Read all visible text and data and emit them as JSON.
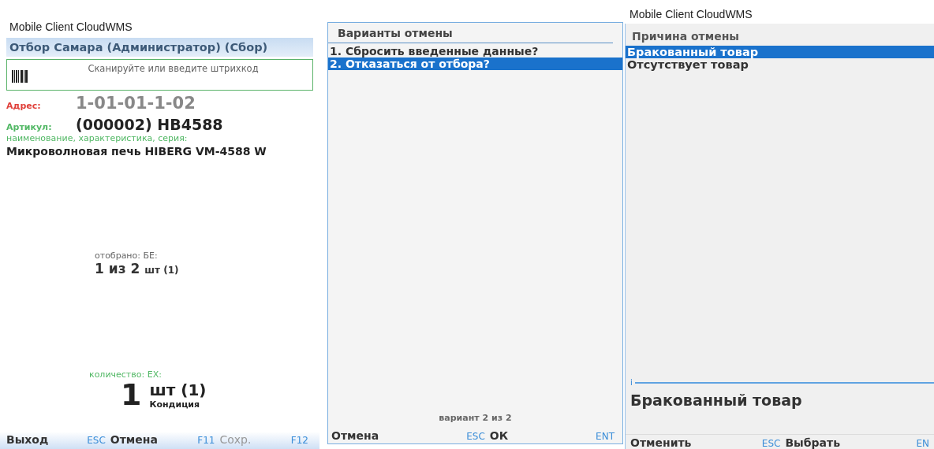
{
  "screen_1": {
    "app_title": "Mobile Client CloudWMS",
    "header": "Отбор Самара (Администратор)  (Сбор)",
    "scan": {
      "placeholder": "Сканируйте или введите штрихкод"
    },
    "address": {
      "label": "Адрес:",
      "value": "1-01-01-1-02"
    },
    "article": {
      "label": "Артикул:",
      "value": "(000002) HB4588"
    },
    "name_label": "наименование,  характеристика,  серия:",
    "name_value": "Микроволновая печь HIBERG VM-4588 W",
    "picked": {
      "label": "отобрано: БЕ:",
      "value": "1 из 2",
      "unit": "шт (1)"
    },
    "quantity": {
      "label": "количество: ЕХ:",
      "value": "1",
      "unit": "шт (1)",
      "condition": "Кондиция"
    },
    "softkeys": [
      {
        "label": "Выход",
        "key": "ESC",
        "disabled": false
      },
      {
        "label": "Отмена",
        "key": "F11",
        "disabled": false
      },
      {
        "label": "Сохр.",
        "key": "F12",
        "disabled": true
      }
    ]
  },
  "screen_2": {
    "dialog_title": "Варианты отмены",
    "options": [
      {
        "label": "1. Сбросить введенные данные?",
        "selected": false
      },
      {
        "label": "2. Отказаться от отбора?",
        "selected": true
      }
    ],
    "counter": "вариант  2 из 2",
    "softkeys": [
      {
        "label": "Отмена",
        "key": "ESC",
        "disabled": false
      },
      {
        "label": "ОК",
        "key": "ENT",
        "disabled": false
      }
    ]
  },
  "screen_3": {
    "app_title": "Mobile Client CloudWMS",
    "header": "Причина отмены",
    "reasons": [
      {
        "label": "Бракованный товар",
        "selected": true
      },
      {
        "label": "Отсутствует товар",
        "selected": false
      }
    ],
    "info_mark": "i",
    "detail": "Бракованный товар",
    "softkeys": [
      {
        "label": "Отменить",
        "key": "ESC",
        "disabled": false
      },
      {
        "label": "Выбрать",
        "key": "EN",
        "disabled": false
      }
    ]
  }
}
